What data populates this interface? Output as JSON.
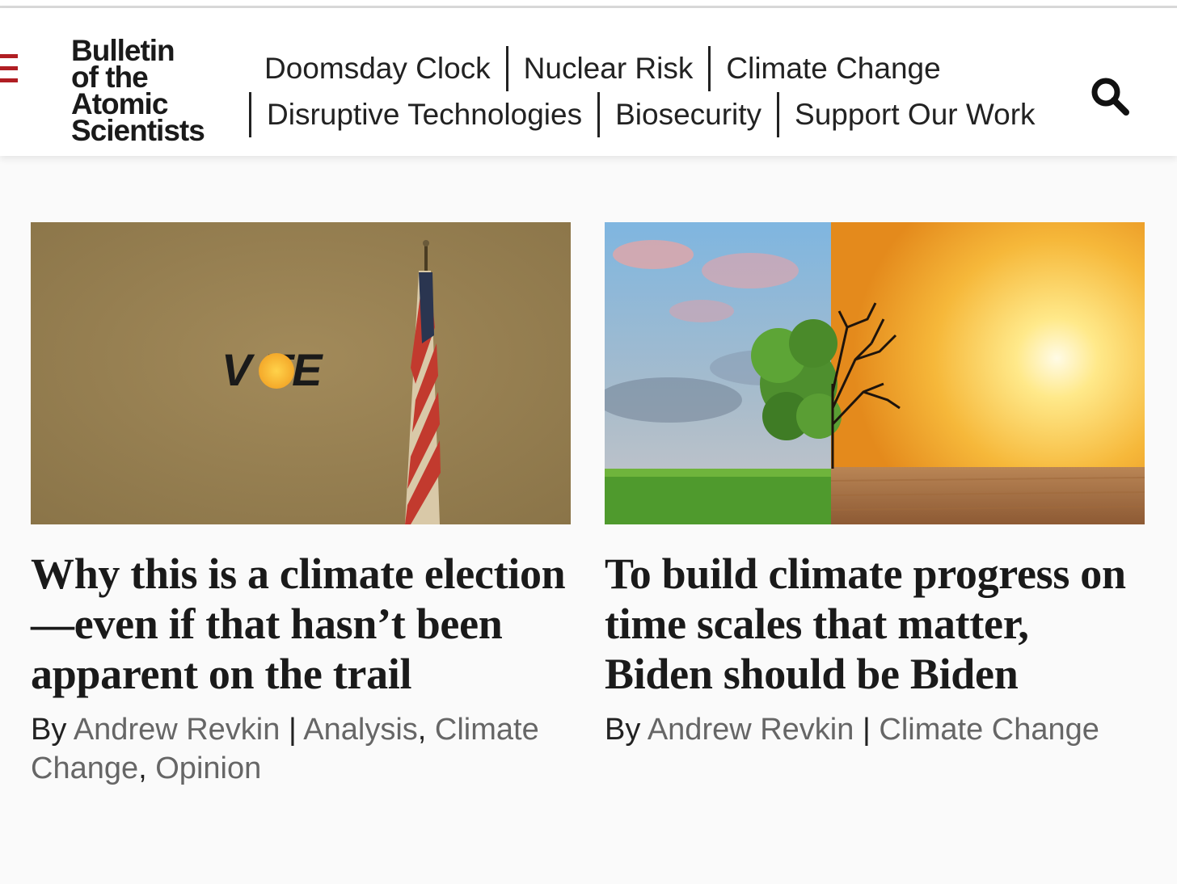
{
  "site": {
    "logo_lines": [
      "Bulletin",
      "of the",
      "Atomic",
      "Scientists"
    ]
  },
  "nav": {
    "row1": [
      "Doomsday Clock",
      "Nuclear Risk",
      "Climate Change"
    ],
    "row2": [
      "Disruptive Technologies",
      "Biosecurity",
      "Support Our Work"
    ]
  },
  "icons": {
    "menu": "hamburger-menu-icon",
    "search": "search-icon"
  },
  "colors": {
    "brand_red": "#b01e23",
    "link_gray": "#666666"
  },
  "articles": [
    {
      "image_text": "V TE",
      "title": "Why this is a climate election—even if that hasn’t been apparent on the trail",
      "by": "By",
      "author": "Andrew Revkin",
      "sep": "|",
      "categories": [
        "Analysis",
        "Climate Change",
        "Opinion"
      ]
    },
    {
      "title": "To build climate progress on time scales that matter, Biden should be Biden",
      "by": "By",
      "author": "Andrew Revkin",
      "sep": "|",
      "categories": [
        "Climate Change"
      ]
    }
  ]
}
